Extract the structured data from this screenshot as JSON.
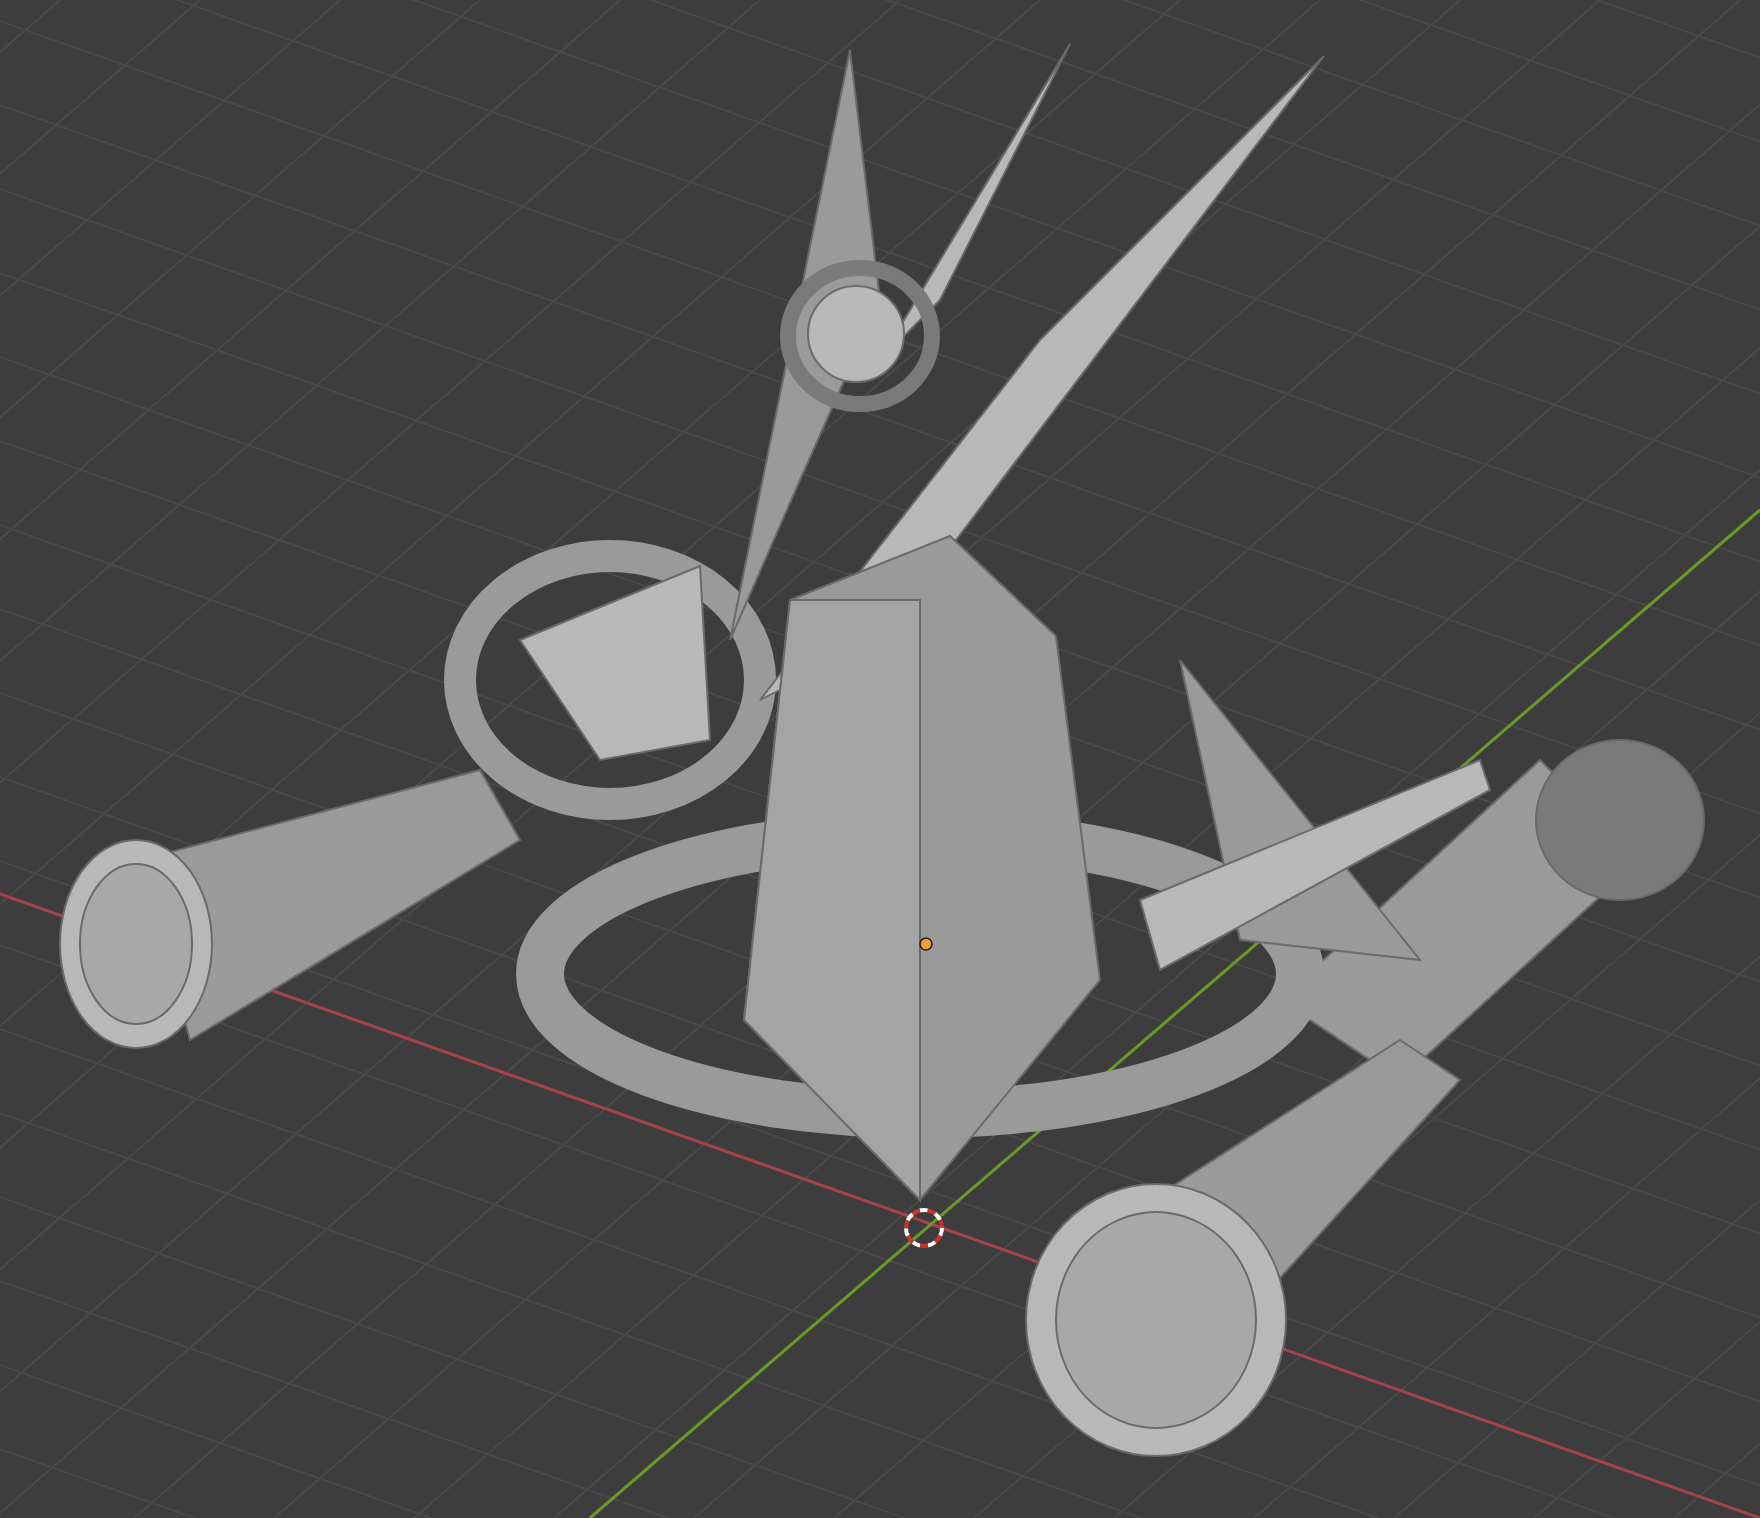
{
  "viewport": {
    "show_grid": true,
    "show_axes": true,
    "cursor_3d": true,
    "origin": true
  }
}
